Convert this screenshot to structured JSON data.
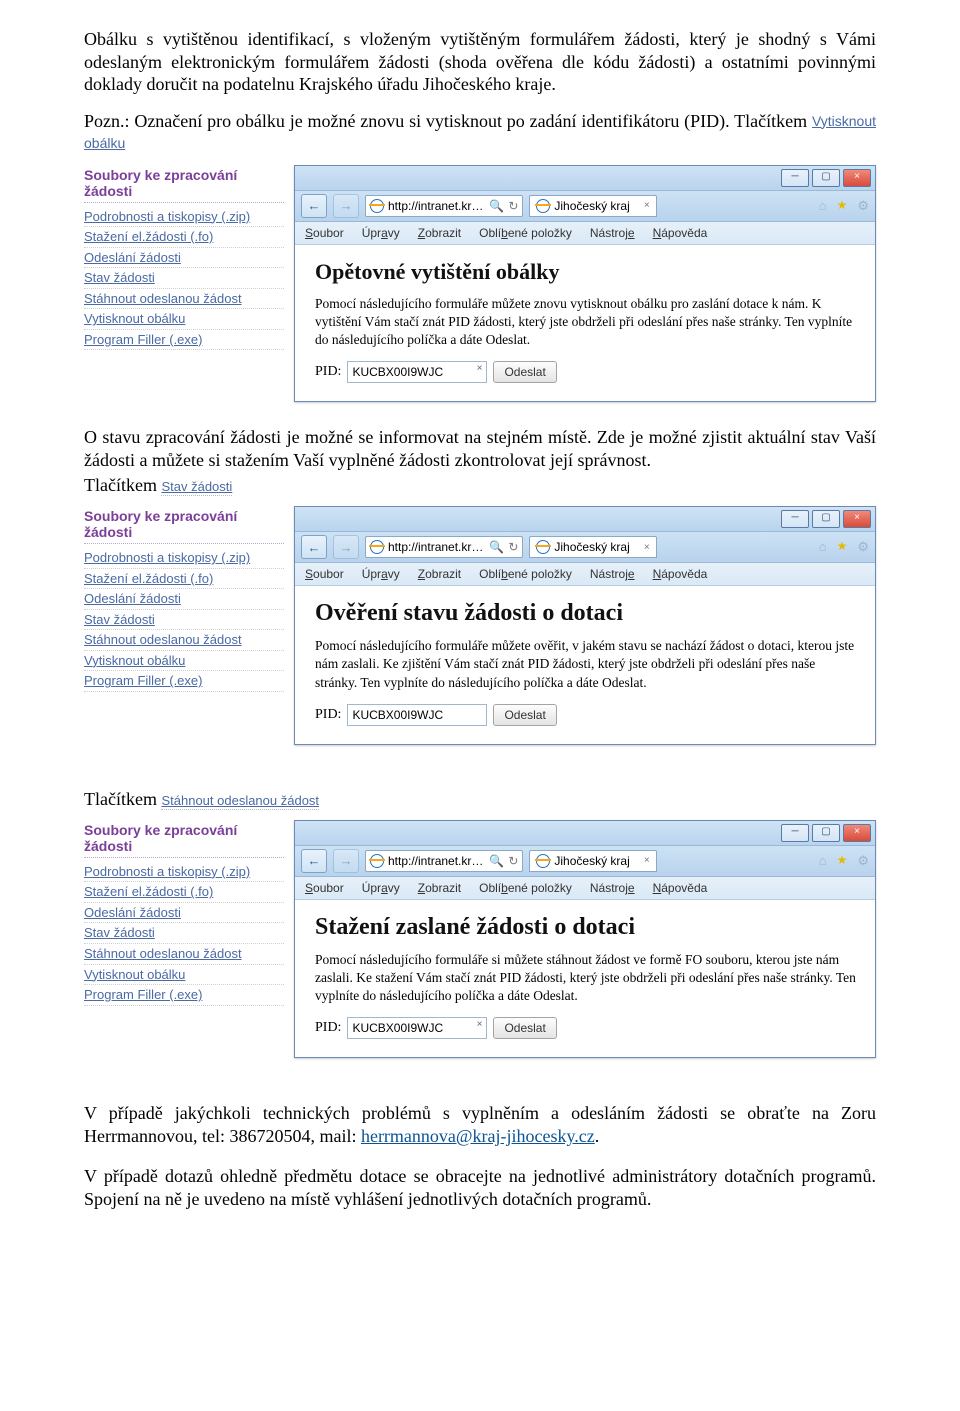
{
  "intro": {
    "p1": "Obálku s vytištěnou identifikací, s vloženým vytištěným formulářem žádosti, který je shodný s Vámi odeslaným elektronickým formulářem žádosti (shoda ověřena dle kódu žádosti) a ostatními povinnými doklady doručit na podatelnu Krajského úřadu Jihočeského kraje.",
    "p2": "Pozn.: Označení pro obálku je možné znovu si vytisknout po zadání identifikátoru (PID). Tlačítkem",
    "btn1": "Vytisknout obálku"
  },
  "mid": {
    "p1": "O stavu zpracování žádosti je možné se informovat na stejném místě. Zde je možné zjistit aktuální stav Vaší žádosti a můžete si stažením Vaší vyplněné žádosti zkontrolovat její správnost.",
    "btn": "Stav žádosti"
  },
  "third_btn": "Stáhnout odeslanou žádost",
  "sidebar": {
    "title": "Soubory ke zpracování žádosti",
    "items": [
      "Podrobnosti a tiskopisy (.zip)",
      "Stažení el.žádosti (.fo)",
      "Odeslání žádosti",
      "Stav žádosti",
      "Stáhnout odeslanou žádost",
      "Vytisknout obálku",
      "Program Filler (.exe)"
    ]
  },
  "ie": {
    "url": "http://intranet.kr…",
    "tab": "Jihočeský kraj",
    "menu": {
      "soubor": "Soubor",
      "upravy": "Úpravy",
      "zobrazit": "Zobrazit",
      "oblib": "Oblíbené položky",
      "nastroje": "Nástroje",
      "napoveda": "Nápověda"
    },
    "symbols": {
      "back": "←",
      "fwd": "→",
      "search": "🔍",
      "refresh": "↻",
      "home": "⌂",
      "star": "★",
      "gear": "⚙",
      "close_x": "×"
    }
  },
  "win1": {
    "title": "Opětovné vytištění obálky",
    "desc": "Pomocí následujícího formuláře můžete znovu vytisknout obálku pro zaslání dotace k nám. K vytištění Vám stačí znát PID žádosti, který jste obdrželi při odeslání přes naše stránky. Ten vyplníte do následujícího políčka a dáte Odeslat.",
    "pidlabel": "PID:",
    "pidvalue": "KUCBX00I9WJC",
    "submit": "Odeslat"
  },
  "win2": {
    "title": "Ověření stavu žádosti o dotaci",
    "desc": "Pomocí následujícího formuláře můžete ověřit, v jakém stavu se nachází žádost o dotaci, kterou jste nám zaslali. Ke zjištění Vám stačí znát PID žádosti, který jste obdrželi při odeslání přes naše stránky. Ten vyplníte do následujícího políčka a dáte Odeslat.",
    "pidlabel": "PID:",
    "pidvalue": "KUCBX00I9WJC",
    "submit": "Odeslat"
  },
  "win3": {
    "title": "Stažení zaslané žádosti o dotaci",
    "desc": "Pomocí následujícího formuláře si můžete stáhnout žádost ve formě FO souboru, kterou jste nám zaslali. Ke stažení Vám stačí znát PID žádosti, který jste obdrželi při odeslání přes naše stránky. Ten vyplníte do následujícího políčka a dáte Odeslat.",
    "pidlabel": "PID:",
    "pidvalue": "KUCBX00I9WJC",
    "submit": "Odeslat"
  },
  "outro": {
    "tlac": "Tlačítkem",
    "p1a": "V případě jakýchkoli technických problémů s vyplněním a odesláním žádosti se obraťte na Zoru Herrmannovou, tel: 386720504, mail: ",
    "mail": "herrmannova@kraj-jihocesky.cz",
    "p1b": ".",
    "p2": "V případě dotazů ohledně předmětu dotace se obracejte na jednotlivé administrátory dotačních programů. Spojení na ně je uvedeno na místě vyhlášení jednotlivých dotačních programů."
  }
}
